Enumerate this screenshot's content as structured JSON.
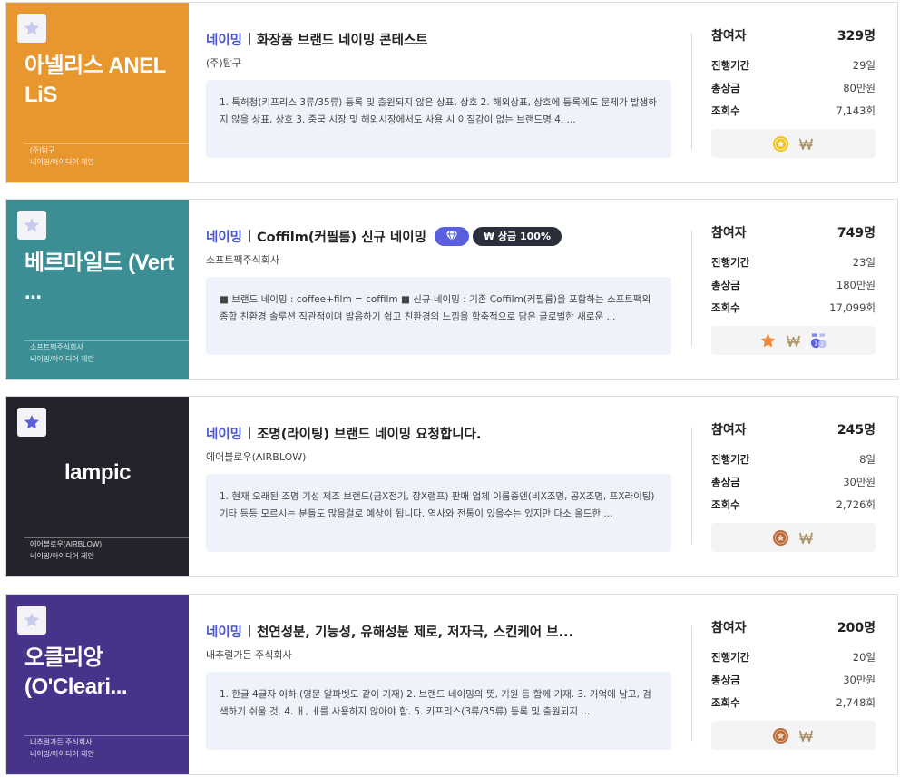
{
  "cards": [
    {
      "thumb": {
        "bg": "#e8962e",
        "title": "아넬리스 ANEL LiS",
        "foot1": "(주)탐구",
        "foot2": "네이밍/아이디어 제안",
        "favorite": false
      },
      "category": "네이밍",
      "title": "화장품 브랜드 네이밍 콘테스트",
      "company": "(주)탐구",
      "description": "1. 특허청(키프리스 3류/35류) 등록 및 출원되지 않은 상표, 상호 2. 해외상표, 상호에 등록에도 문제가 발생하지 않을 상표, 상호 3. 중국 시장 및 해외시장에서도 사용 시 이질감이 없는 브랜드명 4. ...",
      "stats": {
        "participants_label": "참여자",
        "participants": "329명",
        "period_label": "진행기간",
        "period": "29일",
        "prize_label": "총상금",
        "prize": "80만원",
        "views_label": "조회수",
        "views": "7,143회"
      },
      "icons": [
        "gold-medal-icon",
        "won-icon"
      ]
    },
    {
      "thumb": {
        "bg": "#3b8f94",
        "title": "베르마일드 (Vert ...",
        "foot1": "소프트팩주식회사",
        "foot2": "네이밍/아이디어 제안",
        "favorite": false
      },
      "category": "네이밍",
      "title": "Coffilm(커필름) 신규 네이밍",
      "badge_prize": "₩ 상금 100%",
      "company": "소프트팩주식회사",
      "description": "■ 브랜드 네이밍 : coffee+film = coffilm ■ 신규 네이밍 : 기존 Coffilm(커필름)을 포함하는 소프트팩의 종합 친환경 솔루션 직관적이며 발음하기 쉽고 친환경의 느낌을 함축적으로 담은 글로벌한 새로운 ...",
      "stats": {
        "participants_label": "참여자",
        "participants": "749명",
        "period_label": "진행기간",
        "period": "23일",
        "prize_label": "총상금",
        "prize": "180만원",
        "views_label": "조회수",
        "views": "17,099회"
      },
      "icons": [
        "star-icon",
        "won-icon",
        "ranking-medal-icon"
      ]
    },
    {
      "thumb": {
        "bg": "#22232b",
        "title": "lampic",
        "foot1": "에어블로우(AIRBLOW)",
        "foot2": "네이밍/아이디어 제안",
        "favorite": true
      },
      "category": "네이밍",
      "title": "조명(라이팅) 브랜드 네이밍 요청합니다.",
      "company": "에어블로우(AIRBLOW)",
      "description": "1. 현재 오래된 조명 기성 제조 브랜드(금X전기, 장X램프) 판매 업체 이름중엔(비X조명, 공X조명, 프X라이팅) 기타 등등 모르시는 분들도 많을걸로 예상이 됩니다. 역사와 전통이 있을수는 있지만 다소 올드한 ...",
      "stats": {
        "participants_label": "참여자",
        "participants": "245명",
        "period_label": "진행기간",
        "period": "8일",
        "prize_label": "총상금",
        "prize": "30만원",
        "views_label": "조회수",
        "views": "2,726회"
      },
      "icons": [
        "bronze-medal-icon",
        "won-icon"
      ]
    },
    {
      "thumb": {
        "bg": "#47348a",
        "title": "오클리앙(O'Cleari...",
        "foot1": "내추럴가든 주식회사",
        "foot2": "네이밍/아이디어 제안",
        "favorite": false
      },
      "category": "네이밍",
      "title": "천연성분, 기능성, 유해성분 제로, 저자극, 스킨케어 브...",
      "company": "내추럴가든 주식회사",
      "description": "1. 한글 4글자 이하.(영문 알파벳도 같이 기재) 2. 브랜드 네이밍의 뜻, 기원 등 함께 기재. 3. 기억에 남고, 검색하기 쉬울 것. 4. ㅐ, ㅔ를 사용하지 않아야 함. 5. 키프리스(3류/35류) 등록 및 출원되지 ...",
      "stats": {
        "participants_label": "참여자",
        "participants": "200명",
        "period_label": "진행기간",
        "period": "20일",
        "prize_label": "총상금",
        "prize": "30만원",
        "views_label": "조회수",
        "views": "2,748회"
      },
      "icons": [
        "bronze-medal-icon",
        "won-icon"
      ]
    }
  ]
}
